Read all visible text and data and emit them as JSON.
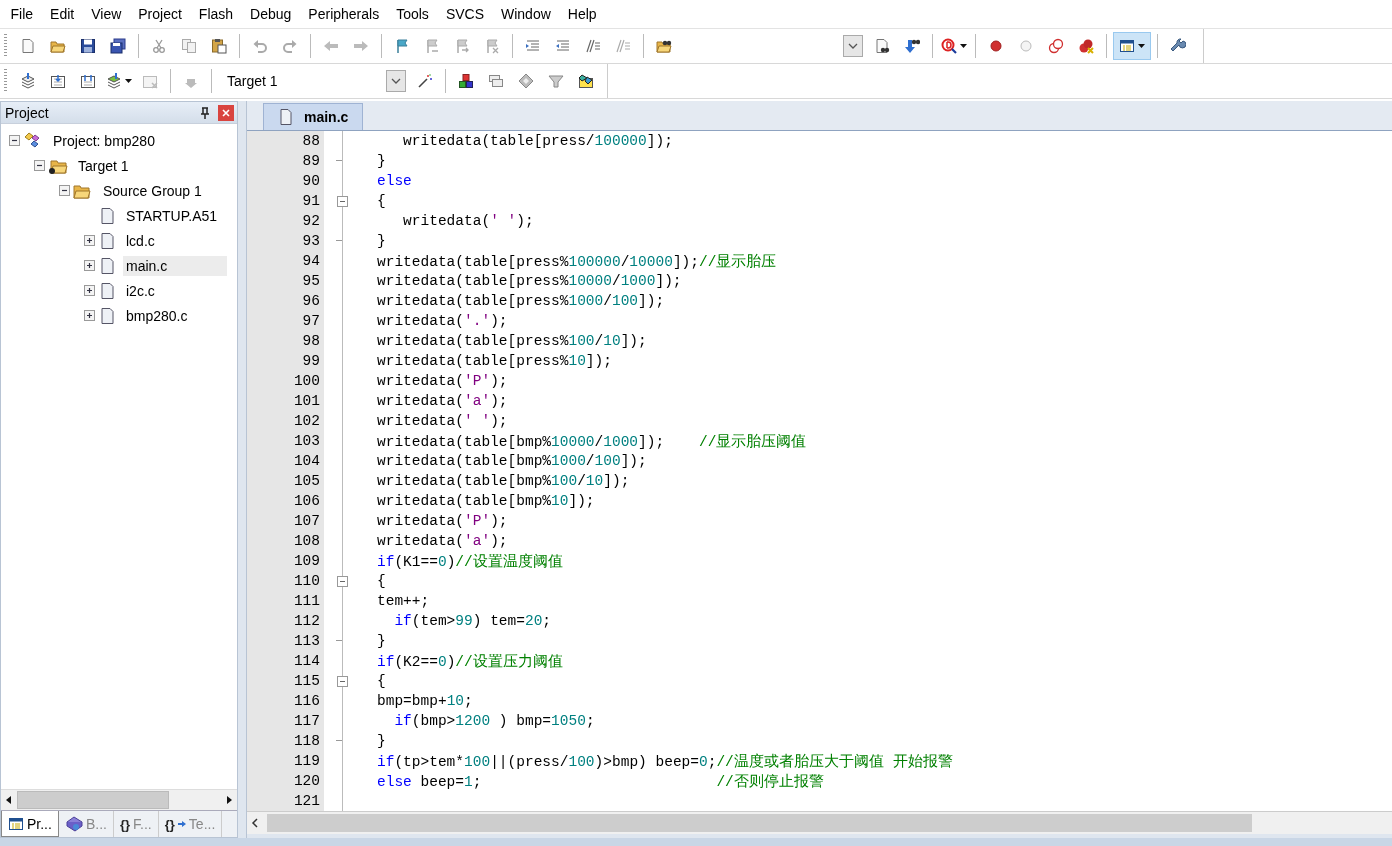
{
  "menu": [
    "File",
    "Edit",
    "View",
    "Project",
    "Flash",
    "Debug",
    "Peripherals",
    "Tools",
    "SVCS",
    "Window",
    "Help"
  ],
  "toolbar": {
    "target_select": "Target 1"
  },
  "project_panel": {
    "title": "Project",
    "tree": [
      {
        "label": "Project: bmp280",
        "kind": "project",
        "expanded": true,
        "selected": false,
        "children": [
          {
            "label": "Target 1",
            "kind": "target",
            "expanded": true,
            "selected": false,
            "children": [
              {
                "label": "Source Group 1",
                "kind": "group",
                "expanded": true,
                "selected": false,
                "children": [
                  {
                    "label": "STARTUP.A51",
                    "kind": "file",
                    "selected": false
                  },
                  {
                    "label": "lcd.c",
                    "kind": "file",
                    "expanded": false,
                    "selected": false
                  },
                  {
                    "label": "main.c",
                    "kind": "file",
                    "expanded": false,
                    "selected": true
                  },
                  {
                    "label": "i2c.c",
                    "kind": "file",
                    "expanded": false,
                    "selected": false
                  },
                  {
                    "label": "bmp280.c",
                    "kind": "file",
                    "expanded": false,
                    "selected": false
                  }
                ]
              }
            ]
          }
        ]
      }
    ],
    "tabs": [
      {
        "label": "Pr...",
        "kind": "project",
        "selected": true
      },
      {
        "label": "B...",
        "kind": "books",
        "selected": false
      },
      {
        "label": "F...",
        "kind": "functions",
        "glyph": "{}",
        "selected": false
      },
      {
        "label": "Te...",
        "kind": "templates",
        "glyph": "{}",
        "selected": false
      }
    ]
  },
  "editor": {
    "tabs": [
      {
        "label": "main.c",
        "selected": true
      }
    ],
    "lines": [
      {
        "number": "88",
        "fold_start": false,
        "fold_end": false,
        "tokens": [
          {
            "kind": "plain",
            "text": "   writedata(table[press/"
          },
          {
            "kind": "number",
            "text": "100000"
          },
          {
            "kind": "plain",
            "text": "]);"
          }
        ]
      },
      {
        "number": "89",
        "fold_start": false,
        "fold_end": true,
        "tokens": [
          {
            "kind": "plain",
            "text": "}"
          }
        ]
      },
      {
        "number": "90",
        "fold_start": false,
        "fold_end": false,
        "tokens": [
          {
            "kind": "keyword",
            "text": "else"
          }
        ]
      },
      {
        "number": "91",
        "fold_start": true,
        "fold_end": false,
        "tokens": [
          {
            "kind": "plain",
            "text": "{"
          }
        ]
      },
      {
        "number": "92",
        "fold_start": false,
        "fold_end": false,
        "tokens": [
          {
            "kind": "plain",
            "text": "   writedata("
          },
          {
            "kind": "string",
            "text": "' '"
          },
          {
            "kind": "plain",
            "text": ");"
          }
        ]
      },
      {
        "number": "93",
        "fold_start": false,
        "fold_end": true,
        "tokens": [
          {
            "kind": "plain",
            "text": "}"
          }
        ]
      },
      {
        "number": "94",
        "fold_start": false,
        "fold_end": false,
        "tokens": [
          {
            "kind": "plain",
            "text": "writedata(table[press%"
          },
          {
            "kind": "number",
            "text": "100000"
          },
          {
            "kind": "plain",
            "text": "/"
          },
          {
            "kind": "number",
            "text": "10000"
          },
          {
            "kind": "plain",
            "text": "]);"
          },
          {
            "kind": "comment",
            "text": "//显示胎压"
          }
        ]
      },
      {
        "number": "95",
        "fold_start": false,
        "fold_end": false,
        "tokens": [
          {
            "kind": "plain",
            "text": "writedata(table[press%"
          },
          {
            "kind": "number",
            "text": "10000"
          },
          {
            "kind": "plain",
            "text": "/"
          },
          {
            "kind": "number",
            "text": "1000"
          },
          {
            "kind": "plain",
            "text": "]);"
          }
        ]
      },
      {
        "number": "96",
        "fold_start": false,
        "fold_end": false,
        "tokens": [
          {
            "kind": "plain",
            "text": "writedata(table[press%"
          },
          {
            "kind": "number",
            "text": "1000"
          },
          {
            "kind": "plain",
            "text": "/"
          },
          {
            "kind": "number",
            "text": "100"
          },
          {
            "kind": "plain",
            "text": "]);"
          }
        ]
      },
      {
        "number": "97",
        "fold_start": false,
        "fold_end": false,
        "tokens": [
          {
            "kind": "plain",
            "text": "writedata("
          },
          {
            "kind": "string",
            "text": "'.'"
          },
          {
            "kind": "plain",
            "text": ");"
          }
        ]
      },
      {
        "number": "98",
        "fold_start": false,
        "fold_end": false,
        "tokens": [
          {
            "kind": "plain",
            "text": "writedata(table[press%"
          },
          {
            "kind": "number",
            "text": "100"
          },
          {
            "kind": "plain",
            "text": "/"
          },
          {
            "kind": "number",
            "text": "10"
          },
          {
            "kind": "plain",
            "text": "]);"
          }
        ]
      },
      {
        "number": "99",
        "fold_start": false,
        "fold_end": false,
        "tokens": [
          {
            "kind": "plain",
            "text": "writedata(table[press%"
          },
          {
            "kind": "number",
            "text": "10"
          },
          {
            "kind": "plain",
            "text": "]);"
          }
        ]
      },
      {
        "number": "100",
        "fold_start": false,
        "fold_end": false,
        "tokens": [
          {
            "kind": "plain",
            "text": "writedata("
          },
          {
            "kind": "string",
            "text": "'P'"
          },
          {
            "kind": "plain",
            "text": ");"
          }
        ]
      },
      {
        "number": "101",
        "fold_start": false,
        "fold_end": false,
        "tokens": [
          {
            "kind": "plain",
            "text": "writedata("
          },
          {
            "kind": "string",
            "text": "'a'"
          },
          {
            "kind": "plain",
            "text": ");"
          }
        ]
      },
      {
        "number": "102",
        "fold_start": false,
        "fold_end": false,
        "tokens": [
          {
            "kind": "plain",
            "text": "writedata("
          },
          {
            "kind": "string",
            "text": "' '"
          },
          {
            "kind": "plain",
            "text": ");"
          }
        ]
      },
      {
        "number": "103",
        "fold_start": false,
        "fold_end": false,
        "tokens": [
          {
            "kind": "plain",
            "text": "writedata(table[bmp%"
          },
          {
            "kind": "number",
            "text": "10000"
          },
          {
            "kind": "plain",
            "text": "/"
          },
          {
            "kind": "number",
            "text": "1000"
          },
          {
            "kind": "plain",
            "text": "]);    "
          },
          {
            "kind": "comment",
            "text": "//显示胎压阈值"
          }
        ]
      },
      {
        "number": "104",
        "fold_start": false,
        "fold_end": false,
        "tokens": [
          {
            "kind": "plain",
            "text": "writedata(table[bmp%"
          },
          {
            "kind": "number",
            "text": "1000"
          },
          {
            "kind": "plain",
            "text": "/"
          },
          {
            "kind": "number",
            "text": "100"
          },
          {
            "kind": "plain",
            "text": "]);"
          }
        ]
      },
      {
        "number": "105",
        "fold_start": false,
        "fold_end": false,
        "tokens": [
          {
            "kind": "plain",
            "text": "writedata(table[bmp%"
          },
          {
            "kind": "number",
            "text": "100"
          },
          {
            "kind": "plain",
            "text": "/"
          },
          {
            "kind": "number",
            "text": "10"
          },
          {
            "kind": "plain",
            "text": "]);"
          }
        ]
      },
      {
        "number": "106",
        "fold_start": false,
        "fold_end": false,
        "tokens": [
          {
            "kind": "plain",
            "text": "writedata(table[bmp%"
          },
          {
            "kind": "number",
            "text": "10"
          },
          {
            "kind": "plain",
            "text": "]);"
          }
        ]
      },
      {
        "number": "107",
        "fold_start": false,
        "fold_end": false,
        "tokens": [
          {
            "kind": "plain",
            "text": "writedata("
          },
          {
            "kind": "string",
            "text": "'P'"
          },
          {
            "kind": "plain",
            "text": ");"
          }
        ]
      },
      {
        "number": "108",
        "fold_start": false,
        "fold_end": false,
        "tokens": [
          {
            "kind": "plain",
            "text": "writedata("
          },
          {
            "kind": "string",
            "text": "'a'"
          },
          {
            "kind": "plain",
            "text": ");"
          }
        ]
      },
      {
        "number": "109",
        "fold_start": false,
        "fold_end": false,
        "tokens": [
          {
            "kind": "keyword",
            "text": "if"
          },
          {
            "kind": "plain",
            "text": "(K1=="
          },
          {
            "kind": "number",
            "text": "0"
          },
          {
            "kind": "plain",
            "text": ")"
          },
          {
            "kind": "comment",
            "text": "//设置温度阈值"
          }
        ]
      },
      {
        "number": "110",
        "fold_start": true,
        "fold_end": false,
        "tokens": [
          {
            "kind": "plain",
            "text": "{"
          }
        ]
      },
      {
        "number": "111",
        "fold_start": false,
        "fold_end": false,
        "tokens": [
          {
            "kind": "plain",
            "text": "tem++;"
          }
        ]
      },
      {
        "number": "112",
        "fold_start": false,
        "fold_end": false,
        "tokens": [
          {
            "kind": "keyword",
            "text": "  if"
          },
          {
            "kind": "plain",
            "text": "(tem>"
          },
          {
            "kind": "number",
            "text": "99"
          },
          {
            "kind": "plain",
            "text": ") tem="
          },
          {
            "kind": "number",
            "text": "20"
          },
          {
            "kind": "plain",
            "text": ";"
          }
        ]
      },
      {
        "number": "113",
        "fold_start": false,
        "fold_end": true,
        "tokens": [
          {
            "kind": "plain",
            "text": "}"
          }
        ]
      },
      {
        "number": "114",
        "fold_start": false,
        "fold_end": false,
        "tokens": [
          {
            "kind": "keyword",
            "text": "if"
          },
          {
            "kind": "plain",
            "text": "(K2=="
          },
          {
            "kind": "number",
            "text": "0"
          },
          {
            "kind": "plain",
            "text": ")"
          },
          {
            "kind": "comment",
            "text": "//设置压力阈值"
          }
        ]
      },
      {
        "number": "115",
        "fold_start": true,
        "fold_end": false,
        "tokens": [
          {
            "kind": "plain",
            "text": "{"
          }
        ]
      },
      {
        "number": "116",
        "fold_start": false,
        "fold_end": false,
        "tokens": [
          {
            "kind": "plain",
            "text": "bmp=bmp+"
          },
          {
            "kind": "number",
            "text": "10"
          },
          {
            "kind": "plain",
            "text": ";"
          }
        ]
      },
      {
        "number": "117",
        "fold_start": false,
        "fold_end": false,
        "tokens": [
          {
            "kind": "keyword",
            "text": "  if"
          },
          {
            "kind": "plain",
            "text": "(bmp>"
          },
          {
            "kind": "number",
            "text": "1200"
          },
          {
            "kind": "plain",
            "text": " ) bmp="
          },
          {
            "kind": "number",
            "text": "1050"
          },
          {
            "kind": "plain",
            "text": ";"
          }
        ]
      },
      {
        "number": "118",
        "fold_start": false,
        "fold_end": true,
        "tokens": [
          {
            "kind": "plain",
            "text": "}"
          }
        ]
      },
      {
        "number": "119",
        "fold_start": false,
        "fold_end": false,
        "tokens": [
          {
            "kind": "keyword",
            "text": "if"
          },
          {
            "kind": "plain",
            "text": "(tp>tem*"
          },
          {
            "kind": "number",
            "text": "100"
          },
          {
            "kind": "plain",
            "text": "||(press/"
          },
          {
            "kind": "number",
            "text": "100"
          },
          {
            "kind": "plain",
            "text": ")>bmp) beep="
          },
          {
            "kind": "number",
            "text": "0"
          },
          {
            "kind": "plain",
            "text": ";"
          },
          {
            "kind": "comment",
            "text": "//温度或者胎压大于阈值 开始报警"
          }
        ]
      },
      {
        "number": "120",
        "fold_start": false,
        "fold_end": false,
        "tokens": [
          {
            "kind": "keyword",
            "text": "else"
          },
          {
            "kind": "plain",
            "text": " beep="
          },
          {
            "kind": "number",
            "text": "1"
          },
          {
            "kind": "plain",
            "text": ";                           "
          },
          {
            "kind": "comment",
            "text": "//否则停止报警"
          }
        ]
      },
      {
        "number": "121",
        "fold_start": false,
        "fold_end": false
      }
    ]
  }
}
